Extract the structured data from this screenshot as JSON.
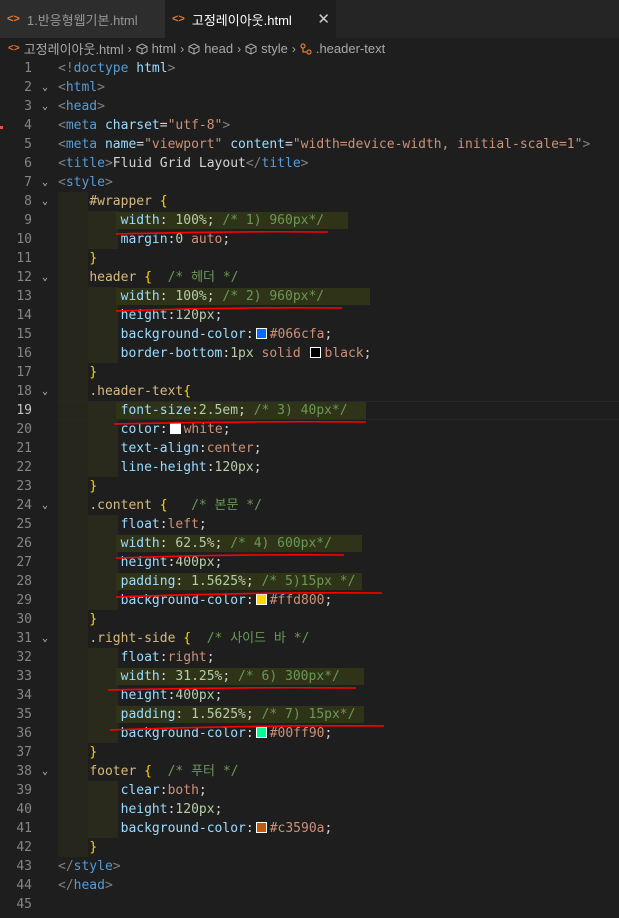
{
  "tabs": [
    {
      "label": "1.반응형웹기본.html",
      "active": false
    },
    {
      "label": "고정레이아웃.html",
      "active": true
    }
  ],
  "breadcrumb": [
    "고정레이아웃.html",
    "html",
    "head",
    "style",
    ".header-text"
  ],
  "colors": {
    "accent": "#e37933",
    "annotation": "#ff0000"
  },
  "lines": [
    {
      "n": "1",
      "tokens": [
        [
          "t-bracket",
          "<!"
        ],
        [
          "t-tag",
          "doctype"
        ],
        [
          "t-plain",
          " "
        ],
        [
          "t-attr",
          "html"
        ],
        [
          "t-bracket",
          ">"
        ]
      ]
    },
    {
      "n": "2",
      "tokens": [
        [
          "t-bracket",
          "<"
        ],
        [
          "t-tag",
          "html"
        ],
        [
          "t-bracket",
          ">"
        ]
      ]
    },
    {
      "n": "3",
      "tokens": [
        [
          "t-bracket",
          "<"
        ],
        [
          "t-tag",
          "head"
        ],
        [
          "t-bracket",
          ">"
        ]
      ]
    },
    {
      "n": "4",
      "tokens": [
        [
          "t-bracket",
          "<"
        ],
        [
          "t-tag",
          "meta"
        ],
        [
          "t-plain",
          " "
        ],
        [
          "t-attr",
          "charset"
        ],
        [
          "t-plain",
          "="
        ],
        [
          "t-str",
          "\"utf-8\""
        ],
        [
          "t-bracket",
          ">"
        ]
      ]
    },
    {
      "n": "5",
      "tokens": [
        [
          "t-bracket",
          "<"
        ],
        [
          "t-tag",
          "meta"
        ],
        [
          "t-plain",
          " "
        ],
        [
          "t-attr",
          "name"
        ],
        [
          "t-plain",
          "="
        ],
        [
          "t-str",
          "\"viewport\""
        ],
        [
          "t-plain",
          " "
        ],
        [
          "t-attr",
          "content"
        ],
        [
          "t-plain",
          "="
        ],
        [
          "t-str",
          "\"width=device-width, initial-scale=1\""
        ],
        [
          "t-bracket",
          ">"
        ]
      ]
    },
    {
      "n": "6",
      "tokens": [
        [
          "t-bracket",
          "<"
        ],
        [
          "t-tag",
          "title"
        ],
        [
          "t-bracket",
          ">"
        ],
        [
          "t-plain",
          "Fluid Grid Layout"
        ],
        [
          "t-bracket",
          "</"
        ],
        [
          "t-tag",
          "title"
        ],
        [
          "t-bracket",
          ">"
        ]
      ]
    },
    {
      "n": "7",
      "tokens": [
        [
          "t-bracket",
          "<"
        ],
        [
          "t-tag",
          "style"
        ],
        [
          "t-bracket",
          ">"
        ]
      ]
    },
    {
      "n": "8",
      "tokens": [
        [
          "t-plain",
          "    "
        ],
        [
          "t-sel",
          "#wrapper"
        ],
        [
          "t-plain",
          " "
        ],
        [
          "t-brace",
          "{"
        ]
      ]
    },
    {
      "n": "9",
      "tokens": [
        [
          "t-plain",
          "        "
        ],
        [
          "t-prop",
          "width"
        ],
        [
          "t-plain",
          ": "
        ],
        [
          "t-num",
          "100%"
        ],
        [
          "t-plain",
          "; "
        ],
        [
          "t-com",
          "/* 1) 960px*/"
        ]
      ]
    },
    {
      "n": "10",
      "tokens": [
        [
          "t-plain",
          "        "
        ],
        [
          "t-prop",
          "margin"
        ],
        [
          "t-plain",
          ":"
        ],
        [
          "t-num",
          "0"
        ],
        [
          "t-plain",
          " "
        ],
        [
          "t-val",
          "auto"
        ],
        [
          "t-plain",
          ";"
        ]
      ]
    },
    {
      "n": "11",
      "tokens": [
        [
          "t-plain",
          "    "
        ],
        [
          "t-brace",
          "}"
        ]
      ]
    },
    {
      "n": "12",
      "tokens": [
        [
          "t-plain",
          "    "
        ],
        [
          "t-sel",
          "header"
        ],
        [
          "t-plain",
          " "
        ],
        [
          "t-brace",
          "{"
        ],
        [
          "t-plain",
          "  "
        ],
        [
          "t-com",
          "/* 헤더 */"
        ]
      ]
    },
    {
      "n": "13",
      "tokens": [
        [
          "t-plain",
          "        "
        ],
        [
          "t-prop",
          "width"
        ],
        [
          "t-plain",
          ": "
        ],
        [
          "t-num",
          "100%"
        ],
        [
          "t-plain",
          "; "
        ],
        [
          "t-com",
          "/* 2) 960px*/"
        ]
      ]
    },
    {
      "n": "14",
      "tokens": [
        [
          "t-plain",
          "        "
        ],
        [
          "t-prop",
          "height"
        ],
        [
          "t-plain",
          ":"
        ],
        [
          "t-num",
          "120px"
        ],
        [
          "t-plain",
          ";"
        ]
      ]
    },
    {
      "n": "15",
      "tokens": [
        [
          "t-plain",
          "        "
        ],
        [
          "t-prop",
          "background-color"
        ],
        [
          "t-plain",
          ":"
        ],
        [
          "swatch",
          "#066cfa"
        ],
        [
          "t-val",
          "#066cfa"
        ],
        [
          "t-plain",
          ";"
        ]
      ]
    },
    {
      "n": "16",
      "tokens": [
        [
          "t-plain",
          "        "
        ],
        [
          "t-prop",
          "border-bottom"
        ],
        [
          "t-plain",
          ":"
        ],
        [
          "t-num",
          "1px"
        ],
        [
          "t-plain",
          " "
        ],
        [
          "t-val",
          "solid"
        ],
        [
          "t-plain",
          " "
        ],
        [
          "swatch",
          "#000000"
        ],
        [
          "t-val",
          "black"
        ],
        [
          "t-plain",
          ";"
        ]
      ]
    },
    {
      "n": "17",
      "tokens": [
        [
          "t-plain",
          "    "
        ],
        [
          "t-brace",
          "}"
        ]
      ]
    },
    {
      "n": "18",
      "tokens": [
        [
          "t-plain",
          "    "
        ],
        [
          "t-sel",
          ".header-text"
        ],
        [
          "t-brace",
          "{"
        ]
      ]
    },
    {
      "n": "19",
      "tokens": [
        [
          "t-plain",
          "        "
        ],
        [
          "t-prop",
          "font-size"
        ],
        [
          "t-plain",
          ":"
        ],
        [
          "t-num",
          "2.5em"
        ],
        [
          "t-plain",
          "; "
        ],
        [
          "t-com",
          "/* 3) 40px*/"
        ]
      ]
    },
    {
      "n": "20",
      "tokens": [
        [
          "t-plain",
          "        "
        ],
        [
          "t-prop",
          "color"
        ],
        [
          "t-plain",
          ":"
        ],
        [
          "swatch",
          "#ffffff"
        ],
        [
          "t-val",
          "white"
        ],
        [
          "t-plain",
          ";"
        ]
      ]
    },
    {
      "n": "21",
      "tokens": [
        [
          "t-plain",
          "        "
        ],
        [
          "t-prop",
          "text-align"
        ],
        [
          "t-plain",
          ":"
        ],
        [
          "t-val",
          "center"
        ],
        [
          "t-plain",
          ";"
        ]
      ]
    },
    {
      "n": "22",
      "tokens": [
        [
          "t-plain",
          "        "
        ],
        [
          "t-prop",
          "line-height"
        ],
        [
          "t-plain",
          ":"
        ],
        [
          "t-num",
          "120px"
        ],
        [
          "t-plain",
          ";"
        ]
      ]
    },
    {
      "n": "23",
      "tokens": [
        [
          "t-plain",
          "    "
        ],
        [
          "t-brace",
          "}"
        ]
      ]
    },
    {
      "n": "24",
      "tokens": [
        [
          "t-plain",
          "    "
        ],
        [
          "t-sel",
          ".content"
        ],
        [
          "t-plain",
          " "
        ],
        [
          "t-brace",
          "{"
        ],
        [
          "t-plain",
          "   "
        ],
        [
          "t-com",
          "/* 본문 */"
        ]
      ]
    },
    {
      "n": "25",
      "tokens": [
        [
          "t-plain",
          "        "
        ],
        [
          "t-prop",
          "float"
        ],
        [
          "t-plain",
          ":"
        ],
        [
          "t-val",
          "left"
        ],
        [
          "t-plain",
          ";"
        ]
      ]
    },
    {
      "n": "26",
      "tokens": [
        [
          "t-plain",
          "        "
        ],
        [
          "t-prop",
          "width"
        ],
        [
          "t-plain",
          ": "
        ],
        [
          "t-num",
          "62.5%"
        ],
        [
          "t-plain",
          "; "
        ],
        [
          "t-com",
          "/* 4) 600px*/"
        ]
      ]
    },
    {
      "n": "27",
      "tokens": [
        [
          "t-plain",
          "        "
        ],
        [
          "t-prop",
          "height"
        ],
        [
          "t-plain",
          ":"
        ],
        [
          "t-num",
          "400px"
        ],
        [
          "t-plain",
          ";"
        ]
      ]
    },
    {
      "n": "28",
      "tokens": [
        [
          "t-plain",
          "        "
        ],
        [
          "t-prop",
          "padding"
        ],
        [
          "t-plain",
          ": "
        ],
        [
          "t-num",
          "1.5625%"
        ],
        [
          "t-plain",
          "; "
        ],
        [
          "t-com",
          "/* 5)15px */"
        ]
      ]
    },
    {
      "n": "29",
      "tokens": [
        [
          "t-plain",
          "        "
        ],
        [
          "t-prop",
          "background-color"
        ],
        [
          "t-plain",
          ":"
        ],
        [
          "swatch",
          "#ffd800"
        ],
        [
          "t-val",
          "#ffd800"
        ],
        [
          "t-plain",
          ";"
        ]
      ]
    },
    {
      "n": "30",
      "tokens": [
        [
          "t-plain",
          "    "
        ],
        [
          "t-brace",
          "}"
        ]
      ]
    },
    {
      "n": "31",
      "tokens": [
        [
          "t-plain",
          "    "
        ],
        [
          "t-sel",
          ".right-side"
        ],
        [
          "t-plain",
          " "
        ],
        [
          "t-brace",
          "{"
        ],
        [
          "t-plain",
          "  "
        ],
        [
          "t-com",
          "/* 사이드 바 */"
        ]
      ]
    },
    {
      "n": "32",
      "tokens": [
        [
          "t-plain",
          "        "
        ],
        [
          "t-prop",
          "float"
        ],
        [
          "t-plain",
          ":"
        ],
        [
          "t-val",
          "right"
        ],
        [
          "t-plain",
          ";"
        ]
      ]
    },
    {
      "n": "33",
      "tokens": [
        [
          "t-plain",
          "        "
        ],
        [
          "t-prop",
          "width"
        ],
        [
          "t-plain",
          ": "
        ],
        [
          "t-num",
          "31.25%"
        ],
        [
          "t-plain",
          "; "
        ],
        [
          "t-com",
          "/* 6) 300px*/"
        ]
      ]
    },
    {
      "n": "34",
      "tokens": [
        [
          "t-plain",
          "        "
        ],
        [
          "t-prop",
          "height"
        ],
        [
          "t-plain",
          ":"
        ],
        [
          "t-num",
          "400px"
        ],
        [
          "t-plain",
          ";"
        ]
      ]
    },
    {
      "n": "35",
      "tokens": [
        [
          "t-plain",
          "        "
        ],
        [
          "t-prop",
          "padding"
        ],
        [
          "t-plain",
          ": "
        ],
        [
          "t-num",
          "1.5625%"
        ],
        [
          "t-plain",
          "; "
        ],
        [
          "t-com",
          "/* 7) 15px*/"
        ]
      ]
    },
    {
      "n": "36",
      "tokens": [
        [
          "t-plain",
          "        "
        ],
        [
          "t-prop",
          "background-color"
        ],
        [
          "t-plain",
          ":"
        ],
        [
          "swatch",
          "#00ff90"
        ],
        [
          "t-val",
          "#00ff90"
        ],
        [
          "t-plain",
          ";"
        ]
      ]
    },
    {
      "n": "37",
      "tokens": [
        [
          "t-plain",
          "    "
        ],
        [
          "t-brace",
          "}"
        ]
      ]
    },
    {
      "n": "38",
      "tokens": [
        [
          "t-plain",
          "    "
        ],
        [
          "t-sel",
          "footer"
        ],
        [
          "t-plain",
          " "
        ],
        [
          "t-brace",
          "{"
        ],
        [
          "t-plain",
          "  "
        ],
        [
          "t-com",
          "/* 푸터 */"
        ]
      ]
    },
    {
      "n": "39",
      "tokens": [
        [
          "t-plain",
          "        "
        ],
        [
          "t-prop",
          "clear"
        ],
        [
          "t-plain",
          ":"
        ],
        [
          "t-val",
          "both"
        ],
        [
          "t-plain",
          ";"
        ]
      ]
    },
    {
      "n": "40",
      "tokens": [
        [
          "t-plain",
          "        "
        ],
        [
          "t-prop",
          "height"
        ],
        [
          "t-plain",
          ":"
        ],
        [
          "t-num",
          "120px"
        ],
        [
          "t-plain",
          ";"
        ]
      ]
    },
    {
      "n": "41",
      "tokens": [
        [
          "t-plain",
          "        "
        ],
        [
          "t-prop",
          "background-color"
        ],
        [
          "t-plain",
          ":"
        ],
        [
          "swatch",
          "#c3590a"
        ],
        [
          "t-val",
          "#c3590a"
        ],
        [
          "t-plain",
          ";"
        ]
      ]
    },
    {
      "n": "42",
      "tokens": [
        [
          "t-plain",
          "    "
        ],
        [
          "t-brace",
          "}"
        ]
      ]
    },
    {
      "n": "43",
      "tokens": [
        [
          "t-bracket",
          "</"
        ],
        [
          "t-tag",
          "style"
        ],
        [
          "t-bracket",
          ">"
        ]
      ]
    },
    {
      "n": "44",
      "tokens": [
        [
          "t-bracket",
          "</"
        ],
        [
          "t-tag",
          "head"
        ],
        [
          "t-bracket",
          ">"
        ]
      ]
    },
    {
      "n": "45",
      "tokens": []
    }
  ]
}
